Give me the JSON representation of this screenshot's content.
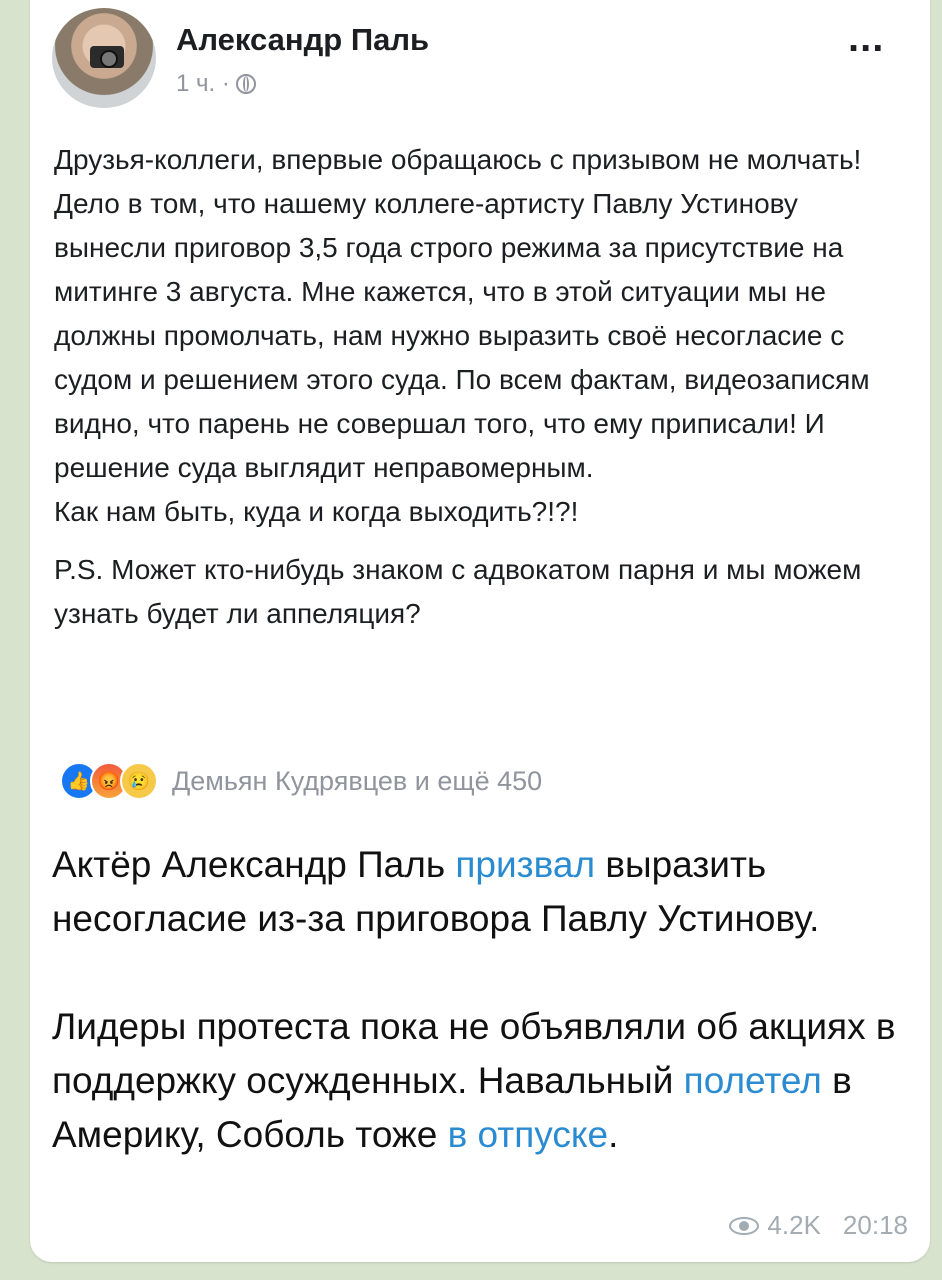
{
  "post": {
    "author": "Александр Паль",
    "time": "1 ч. ·",
    "more": "...",
    "paragraphs": [
      "Друзья-коллеги, впервые обращаюсь с призывом не молчать! Дело в том, что нашему коллеге-артисту Павлу Устинову вынесли приговор 3,5 года строго режима за присутствие на митинге 3 августа. Мне кажется, что в этой ситуации мы не должны промолчать, нам нужно выразить своё несогласие с судом и решением этого суда. По всем фактам, видеозаписям видно, что парень не совершал того, что ему приписали! И решение суда выглядит неправомерным.",
      "Как нам быть, куда и когда выходить?!?!",
      "P.S. Может кто-нибудь знаком с адвокатом парня и мы можем узнать будет ли аппеляция?"
    ],
    "reactions_text": "Демьян Кудрявцев и ещё 450",
    "reaction_icons": [
      "like-icon",
      "angry-icon",
      "sad-icon"
    ]
  },
  "caption": {
    "p1_before": "Актёр Александр Паль ",
    "p1_link": "призвал",
    "p1_after": " выразить несогласие из-за приговора Павлу Устинову.",
    "p2_before": "Лидеры протеста пока не объявляли об акциях в поддержку осужденных. Навальный ",
    "p2_link1": "полетел",
    "p2_middle": " в Америку, Соболь тоже ",
    "p2_link2": "в отпуске",
    "p2_after": "."
  },
  "footer": {
    "views": "4.2K",
    "time": "20:18"
  },
  "colors": {
    "link": "#2a8bd1",
    "background": "#d7e3cd"
  }
}
